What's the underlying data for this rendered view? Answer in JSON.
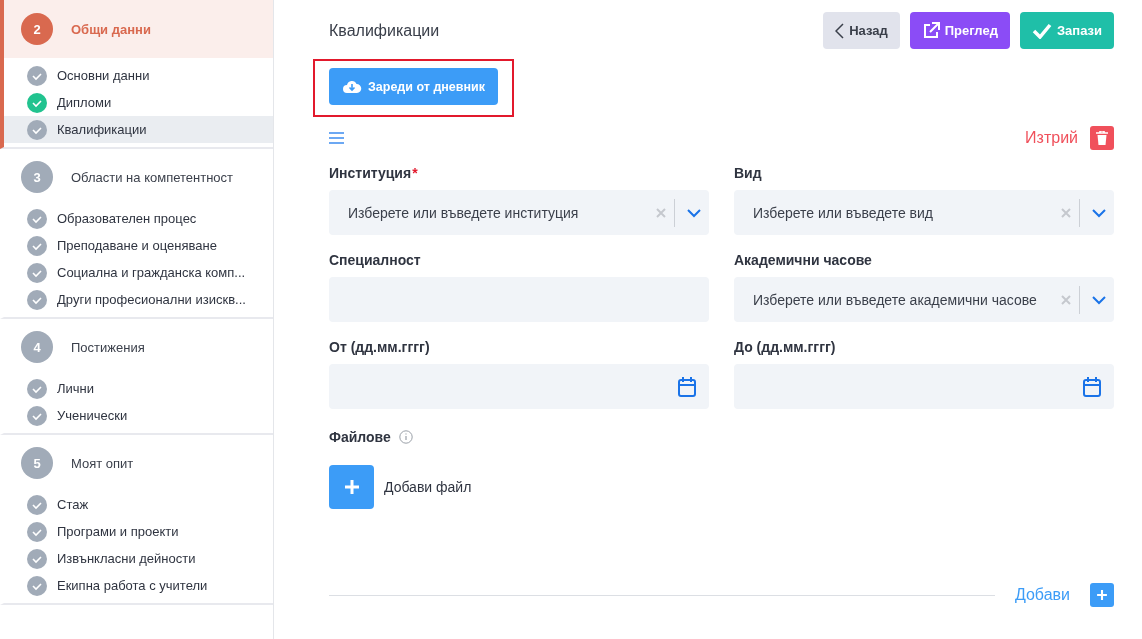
{
  "sidebar": {
    "steps": [
      {
        "number": "2",
        "title": "Общи данни",
        "selected": true,
        "items": [
          {
            "label": "Основни данни",
            "done": false,
            "selected": false
          },
          {
            "label": "Дипломи",
            "done": true,
            "selected": false
          },
          {
            "label": "Квалификации",
            "done": false,
            "selected": true
          }
        ]
      },
      {
        "number": "3",
        "title": "Области на компетентност",
        "selected": false,
        "items": [
          {
            "label": "Образователен процес",
            "done": false,
            "selected": false
          },
          {
            "label": "Преподаване и оценяване",
            "done": false,
            "selected": false
          },
          {
            "label": "Социална и гражданска комп...",
            "done": false,
            "selected": false
          },
          {
            "label": "Други професионални изискв...",
            "done": false,
            "selected": false
          }
        ]
      },
      {
        "number": "4",
        "title": "Постижения",
        "selected": false,
        "items": [
          {
            "label": "Лични",
            "done": false,
            "selected": false
          },
          {
            "label": "Ученически",
            "done": false,
            "selected": false
          }
        ]
      },
      {
        "number": "5",
        "title": "Моят опит",
        "selected": false,
        "items": [
          {
            "label": "Стаж",
            "done": false,
            "selected": false
          },
          {
            "label": "Програми и проекти",
            "done": false,
            "selected": false
          },
          {
            "label": "Извънкласни дейности",
            "done": false,
            "selected": false
          },
          {
            "label": "Екипна работа с учители",
            "done": false,
            "selected": false
          }
        ]
      }
    ]
  },
  "page_title": "Квалификации",
  "actions": [
    {
      "kind": "back",
      "label": "Назад"
    },
    {
      "kind": "preview",
      "label": "Преглед"
    },
    {
      "kind": "save",
      "label": "Запази"
    }
  ],
  "load_button": "Зареди от дневник",
  "delete_label": "Изтрий",
  "fields": [
    {
      "kind": "select",
      "label": "Институция",
      "required_mark": "*",
      "placeholder": "Изберете или въведете институция"
    },
    {
      "kind": "select",
      "label": "Вид",
      "placeholder": "Изберете или въведете вид"
    },
    {
      "kind": "text",
      "label": "Специалност"
    },
    {
      "kind": "select",
      "label": "Академични часове",
      "placeholder": "Изберете или въведете академични часове"
    },
    {
      "kind": "date",
      "label": "От (дд.мм.гггг)"
    },
    {
      "kind": "date",
      "label": "До (дд.мм.гггг)"
    }
  ],
  "files_label": "Файлове",
  "add_file": "Добави файл",
  "add_label": "Добави"
}
